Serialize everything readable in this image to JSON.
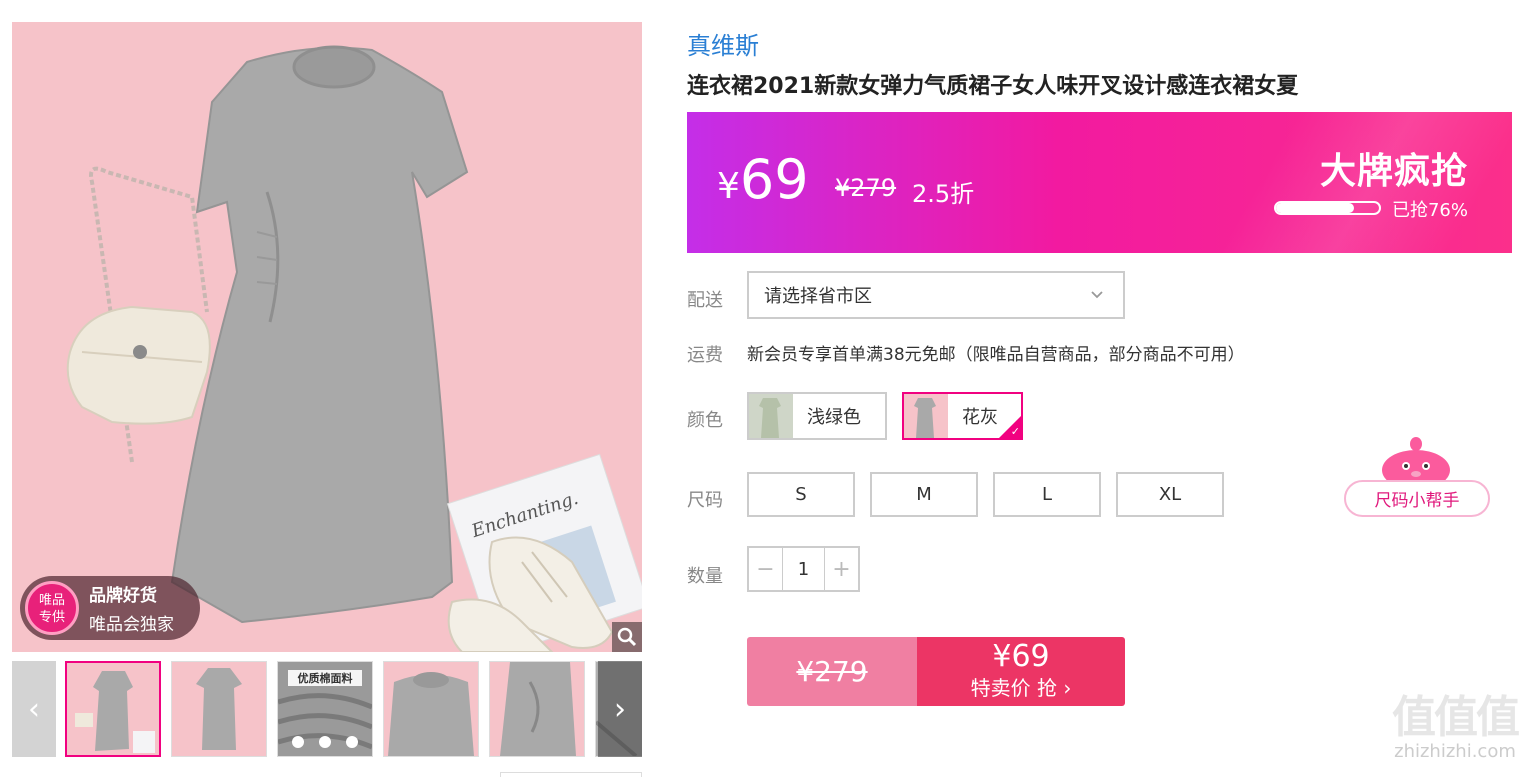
{
  "brand": "真维斯",
  "title": "连衣裙2021新款女弹力气质裙子女人味开叉设计感连衣裙女夏",
  "gallery": {
    "badge_circle_line1": "唯品",
    "badge_circle_line2": "专供",
    "badge_line1": "品牌好货",
    "badge_line2": "唯品会独家",
    "thumb3_label": "优质棉面料",
    "magazine_text": "Enchanting.",
    "icons": {
      "zoom": "zoom-icon",
      "prev": "chevron-left-icon",
      "next": "chevron-right-icon"
    }
  },
  "price_bar": {
    "currency": "¥",
    "price": "69",
    "original_price": "¥279",
    "discount": "2.5折",
    "promo_title": "大牌疯抢",
    "progress_text": "已抢76%",
    "progress_value": 0.76,
    "colors": {
      "from": "#c42ee8",
      "to": "#fb2f8b"
    }
  },
  "delivery": {
    "label": "配送",
    "placeholder": "请选择省市区",
    "icon": "chevron-down-icon"
  },
  "shipping": {
    "label": "运费",
    "text": "新会员专享首单满38元免邮（限唯品自营商品，部分商品不可用）"
  },
  "color": {
    "label": "颜色",
    "options": [
      {
        "name": "浅绿色",
        "selected": false
      },
      {
        "name": "花灰",
        "selected": true
      }
    ],
    "accent": "#f10180"
  },
  "size": {
    "label": "尺码",
    "options": [
      "S",
      "M",
      "L",
      "XL"
    ],
    "helper": "尺码小帮手"
  },
  "quantity": {
    "label": "数量",
    "value": "1",
    "minus": "−",
    "plus": "+"
  },
  "buy": {
    "original_price": "¥279",
    "price": "¥69",
    "action": "特卖价 抢 ›"
  },
  "watermark": {
    "logo": "值值值",
    "url": "zhizhizhi.com"
  }
}
